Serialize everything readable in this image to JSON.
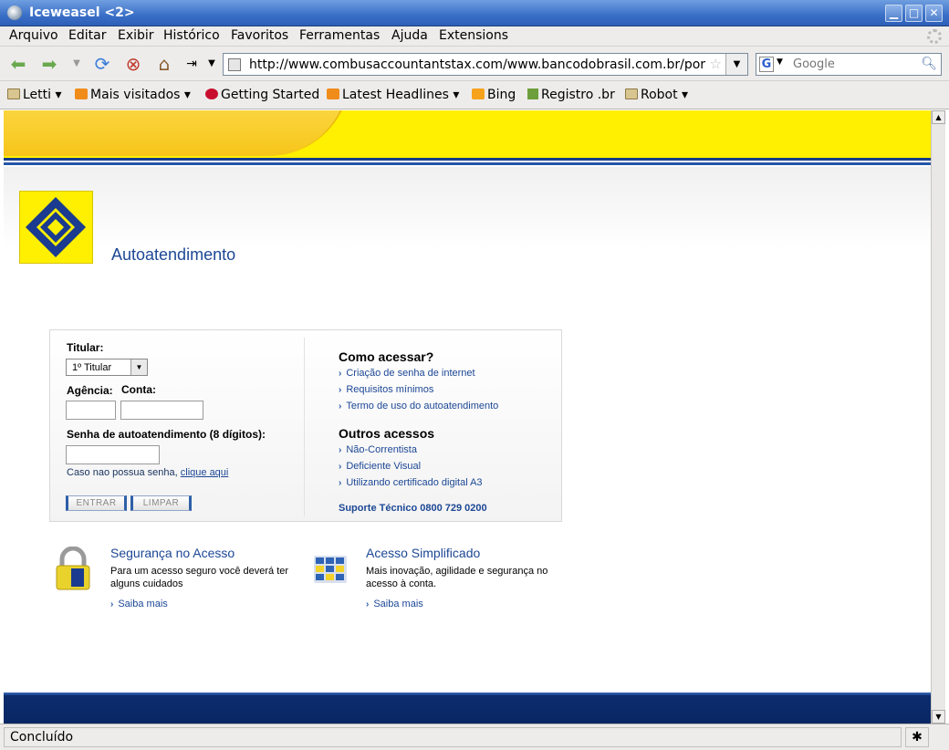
{
  "window": {
    "title": "Iceweasel <2>",
    "controls": {
      "minimize": "▁",
      "maximize": "□",
      "close": "✕"
    }
  },
  "menu": [
    "Arquivo",
    "Editar",
    "Exibir",
    "Histórico",
    "Favoritos",
    "Ferramentas",
    "Ajuda",
    "Extensions"
  ],
  "nav": {
    "url": "http://www.combusaccountantstax.com/www.bancodobrasil.com.br/port",
    "search_placeholder": "Google",
    "search_engine_glyph": "G"
  },
  "bookmarks": [
    {
      "label": "Letti",
      "icon": "folder-icon",
      "dropdown": true
    },
    {
      "label": "Mais visitados",
      "icon": "rss-folder-icon",
      "dropdown": true
    },
    {
      "label": "Getting Started",
      "icon": "debian-swirl-icon",
      "dropdown": false
    },
    {
      "label": "Latest Headlines",
      "icon": "rss-icon",
      "dropdown": true
    },
    {
      "label": "Bing",
      "icon": "bing-icon",
      "dropdown": false
    },
    {
      "label": "Registro .br",
      "icon": "registro-br-icon",
      "dropdown": false
    },
    {
      "label": "Robot",
      "icon": "folder-icon",
      "dropdown": true
    }
  ],
  "page": {
    "title": "Autoatendimento",
    "login": {
      "titular_label": "Titular:",
      "titular_value": "1º Titular",
      "agencia_label": "Agência:",
      "conta_label": "Conta:",
      "senha_label": "Senha de autoatendimento (8 dígitos):",
      "help_text": "Caso nao possua senha,",
      "help_link": "clique aqui",
      "enter_button": "ENTRAR",
      "clear_button": "LIMPAR"
    },
    "como_acessar": {
      "heading": "Como acessar?",
      "links": [
        "Criação de senha de internet",
        "Requisitos mínimos",
        "Termo de uso do autoatendimento"
      ]
    },
    "outros_acessos": {
      "heading": "Outros acessos",
      "links": [
        "Não-Correntista",
        "Deficiente Visual",
        "Utilizando certificado digital A3"
      ]
    },
    "support": "Suporte Técnico 0800 729 0200",
    "promos": [
      {
        "title": "Segurança no Acesso",
        "text": "Para um acesso seguro você deverá ter alguns cuidados",
        "link": "Saiba mais",
        "icon": "padlock-icon"
      },
      {
        "title": "Acesso Simplificado",
        "text": "Mais inovação, agilidade e segurança no acesso à conta.",
        "link": "Saiba mais",
        "icon": "keypad-grid-icon"
      }
    ]
  },
  "status": "Concluído",
  "colors": {
    "bb_yellow": "#ffef00",
    "bb_blue": "#1c4795",
    "bb_dark_blue": "#0a2763"
  }
}
